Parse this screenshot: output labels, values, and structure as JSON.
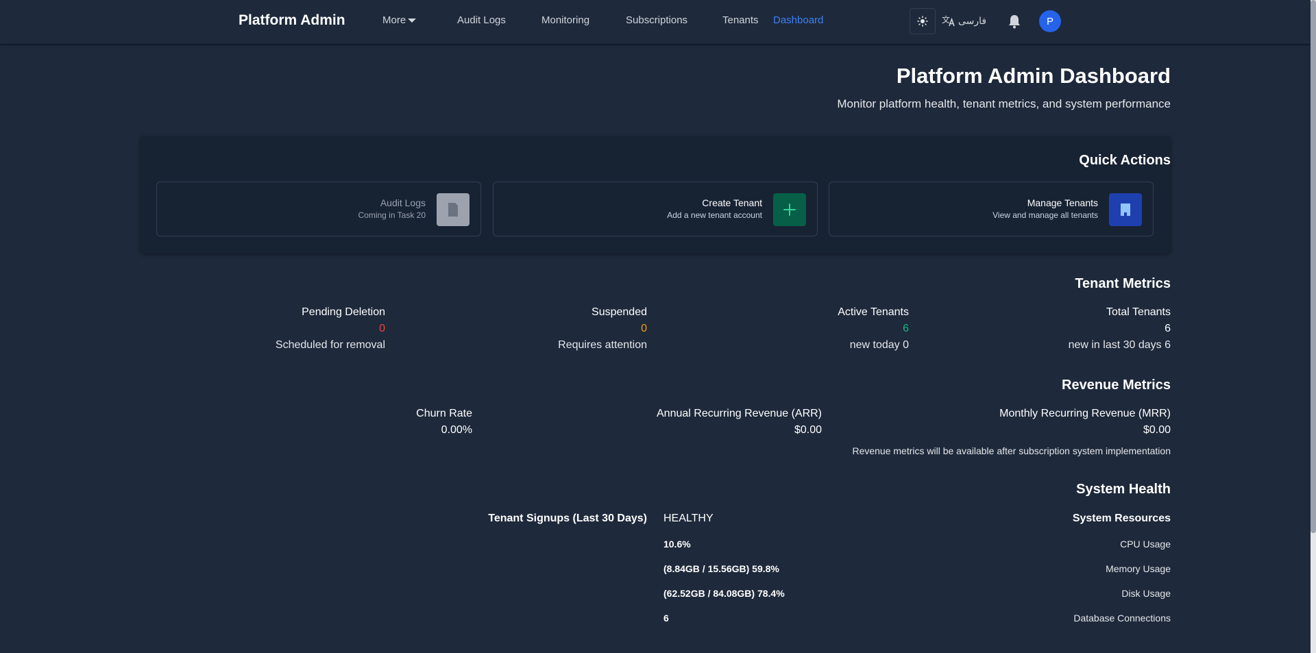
{
  "nav": {
    "brand": "Platform Admin",
    "more": "More",
    "audit_logs": "Audit Logs",
    "monitoring": "Monitoring",
    "subscriptions": "Subscriptions",
    "tenants": "Tenants",
    "dashboard": "Dashboard",
    "language": "فارسی",
    "avatar_initial": "P",
    "accent_color": "#3b82f6"
  },
  "header": {
    "title": "Platform Admin Dashboard",
    "subtitle": "Monitor platform health, tenant metrics, and system performance"
  },
  "quick_actions": {
    "title": "Quick Actions",
    "items": [
      {
        "title": "Audit Logs",
        "subtitle": "Coming in Task 20",
        "icon": "document-icon",
        "color": "#9ca3af"
      },
      {
        "title": "Create Tenant",
        "subtitle": "Add a new tenant account",
        "icon": "plus-icon",
        "color": "#065f46"
      },
      {
        "title": "Manage Tenants",
        "subtitle": "View and manage all tenants",
        "icon": "building-icon",
        "color": "#1e40af"
      }
    ]
  },
  "tenant_metrics": {
    "title": "Tenant Metrics",
    "items": [
      {
        "label": "Pending Deletion",
        "value": "0",
        "note": "Scheduled for removal",
        "color": "#ef4444"
      },
      {
        "label": "Suspended",
        "value": "0",
        "note": "Requires attention",
        "color": "#f59e0b"
      },
      {
        "label": "Active Tenants",
        "value": "6",
        "note": "new today 0",
        "color": "#10b981"
      },
      {
        "label": "Total Tenants",
        "value": "6",
        "note": "new in last 30 days 6",
        "color": "#ffffff"
      }
    ]
  },
  "revenue_metrics": {
    "title": "Revenue Metrics",
    "items": [
      {
        "label": "Churn Rate",
        "value": "0.00%"
      },
      {
        "label": "Annual Recurring Revenue (ARR)",
        "value": "$0.00"
      },
      {
        "label": "Monthly Recurring Revenue (MRR)",
        "value": "$0.00"
      }
    ],
    "note": "Revenue metrics will be available after subscription system implementation"
  },
  "system_health": {
    "title": "System Health",
    "signups_title": "Tenant Signups (Last 30 Days)",
    "status": "HEALTHY",
    "resources_title": "System Resources",
    "resources": [
      {
        "label": "CPU Usage",
        "value": "10.6%"
      },
      {
        "label": "Memory Usage",
        "value": "(8.84GB / 15.56GB) 59.8%"
      },
      {
        "label": "Disk Usage",
        "value": "(62.52GB / 84.08GB) 78.4%"
      },
      {
        "label": "Database Connections",
        "value": "6"
      }
    ]
  }
}
